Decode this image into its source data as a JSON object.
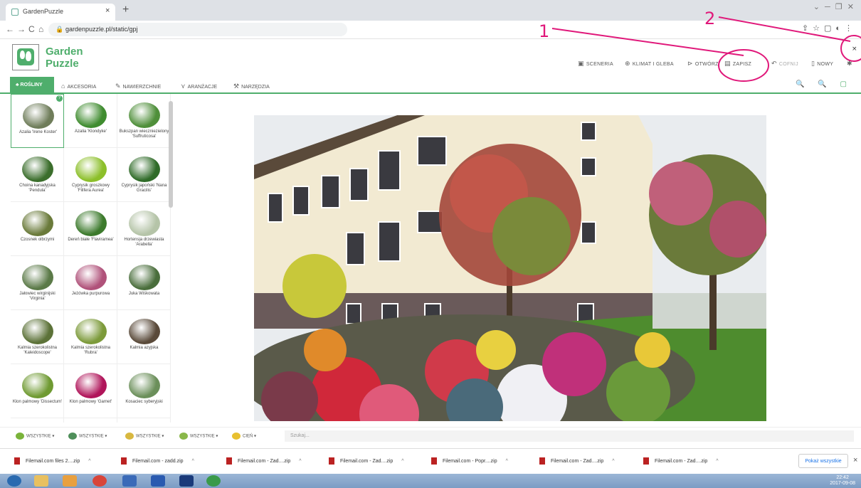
{
  "browser": {
    "tab_title": "GardenPuzzle",
    "tab_close": "×",
    "new_tab": "+",
    "url": "gardenpuzzle.pl/static/gpj",
    "nav_back": "←",
    "nav_forward": "→",
    "nav_reload": "C",
    "nav_home": "⌂",
    "window_controls": "⌄ ─ ❐ ✕"
  },
  "app": {
    "logo_line1": "Garden",
    "logo_line2": "Puzzle",
    "menu": [
      {
        "icon": "image-icon",
        "glyph": "▣",
        "label": "SCENERIA"
      },
      {
        "icon": "climate-icon",
        "glyph": "⊕",
        "label": "KLIMAT I GLEBA"
      },
      {
        "icon": "folder-open-icon",
        "glyph": "⊳",
        "label": "OTWÓRZ"
      },
      {
        "icon": "save-icon",
        "glyph": "▤",
        "label": "ZAPISZ"
      },
      {
        "icon": "undo-icon",
        "glyph": "↶",
        "label": "COFNIJ"
      },
      {
        "icon": "new-file-icon",
        "glyph": "▯",
        "label": "NOWY"
      },
      {
        "icon": "gear-icon",
        "glyph": "✱",
        "label": ""
      }
    ],
    "categories": [
      {
        "icon": "plant-icon",
        "glyph": "♣",
        "label": "ROŚLINY"
      },
      {
        "icon": "home-icon",
        "glyph": "⌂",
        "label": "AKCESORIA"
      },
      {
        "icon": "brush-icon",
        "glyph": "✎",
        "label": "NAWIERZCHNIE"
      },
      {
        "icon": "arrange-icon",
        "glyph": "⋎",
        "label": "ARANŻACJE"
      },
      {
        "icon": "tools-icon",
        "glyph": "⚒",
        "label": "NARZĘDZIA"
      }
    ],
    "zoom_icons": "🔍 🔍 ▢"
  },
  "plants": [
    {
      "label": "Azalia 'Irene Koster'",
      "color": "#6f7d5a"
    },
    {
      "label": "Azalia 'Klondyke'",
      "color": "#3f8c2f"
    },
    {
      "label": "Bukszpan wieczniezielony 'Suffruticosa'",
      "color": "#4f8f3a"
    },
    {
      "label": "Choina kanadyjska 'Pendula'",
      "color": "#3b6e2c"
    },
    {
      "label": "Cyprysik groszkowy 'Filifera Aurea'",
      "color": "#8cbf2a"
    },
    {
      "label": "Cyprysik japoński 'Nana Gracilis'",
      "color": "#2f6b28"
    },
    {
      "label": "Czosnek olbrzymi",
      "color": "#6a7a3a"
    },
    {
      "label": "Dereń białe 'Flaviramea'",
      "color": "#3c7a2c"
    },
    {
      "label": "Hortensja drzewiasta 'Arabella'",
      "color": "#b5c4a8"
    },
    {
      "label": "Jałowiec wirginijski 'Virginia'",
      "color": "#5b7a48"
    },
    {
      "label": "Jeżówka purpurowa",
      "color": "#b0527a"
    },
    {
      "label": "Juka Wiśkowata",
      "color": "#4a6e3c"
    },
    {
      "label": "Kalmia szerokolistna 'Kaleidoscope'",
      "color": "#5c7238"
    },
    {
      "label": "Kalmia szerokolistna 'Rubra'",
      "color": "#7c9a3a"
    },
    {
      "label": "Kalmia azyjska",
      "color": "#5a4a3a"
    },
    {
      "label": "Klon palmowy 'Dissectum'",
      "color": "#6f9a32"
    },
    {
      "label": "Klon palmowy 'Garnet'",
      "color": "#b0155a"
    },
    {
      "label": "Kosaciec syberyjski",
      "color": "#6b8f5a"
    },
    {
      "label": "",
      "color": "#5a8a3a"
    },
    {
      "label": "",
      "color": "#6b9a4a"
    },
    {
      "label": "",
      "color": "#4a7a3a"
    }
  ],
  "filters": [
    {
      "label": "WSZYSTKIE",
      "color": "#7ab33a"
    },
    {
      "label": "WSZYSTKIE",
      "color": "#4f8f5a"
    },
    {
      "label": "WSZYSTKIE",
      "color": "#d8b840"
    },
    {
      "label": "WSZYSTKIE",
      "color": "#8ab84a"
    },
    {
      "label": "cień",
      "color": "#e8c030"
    }
  ],
  "search_placeholder": "Szukaj...",
  "downloads": [
    "Filemail.com files 2....zip",
    "Filemail.com - zadd.zip",
    "Filemail.com - Zad....zip",
    "Filemail.com - Zad....zip",
    "Filemail.com - Popr....zip",
    "Filemail.com - Zad....zip",
    "Filemail.com - Zad....zip"
  ],
  "downloads_show_all": "Pokaż wszystkie",
  "downloads_close": "×",
  "annotations": {
    "one": "1",
    "two": "2"
  },
  "clock": {
    "time": "22:42",
    "date": "2017-09-08"
  }
}
